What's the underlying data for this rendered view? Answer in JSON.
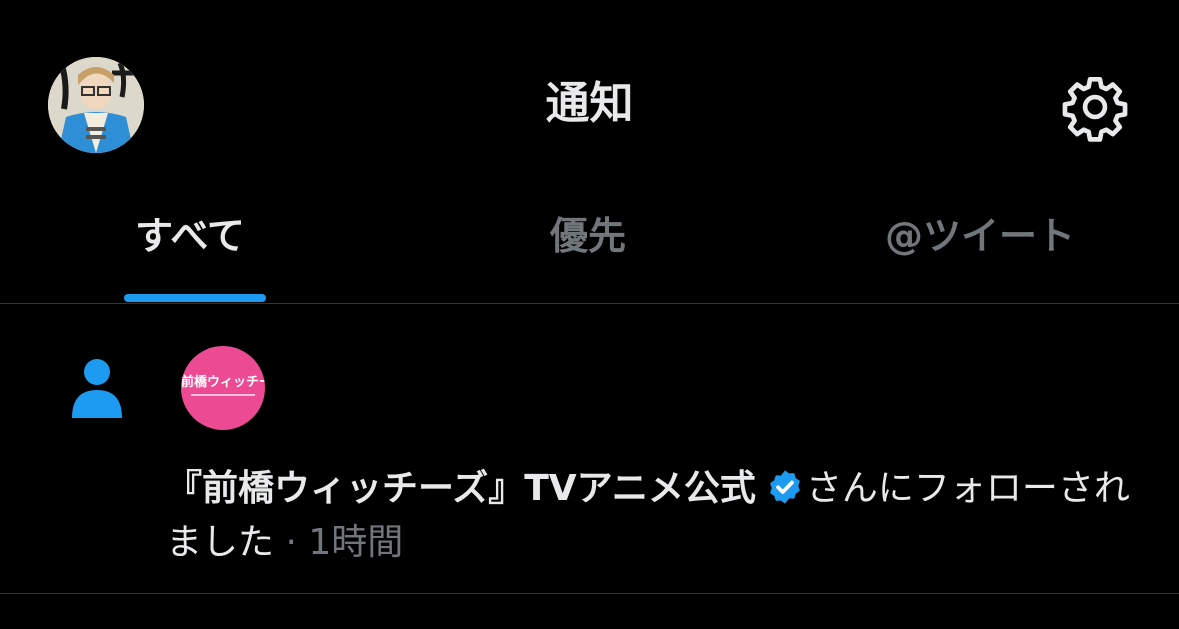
{
  "header": {
    "title": "通知",
    "avatar_icon": "user-avatar-image",
    "settings_icon": "gear-icon"
  },
  "tabs": [
    {
      "label": "すべて",
      "active": true
    },
    {
      "label": "優先",
      "active": false
    },
    {
      "label": "@ツイート",
      "active": false
    }
  ],
  "notification": {
    "type_icon": "follow-person-icon",
    "account_avatar_label": "前橋ウィッチーズ",
    "account_name": "『前橋ウィッチーズ』TVアニメ公式",
    "verified": true,
    "message": "さんにフォローされました",
    "separator": " · ",
    "time": "1時間"
  },
  "colors": {
    "background": "#000000",
    "accent": "#1d9bf0",
    "text_primary": "#e7e9ea",
    "text_secondary": "#71767b",
    "divider": "#2f3336",
    "account_avatar_bg": "#ec4b93"
  }
}
